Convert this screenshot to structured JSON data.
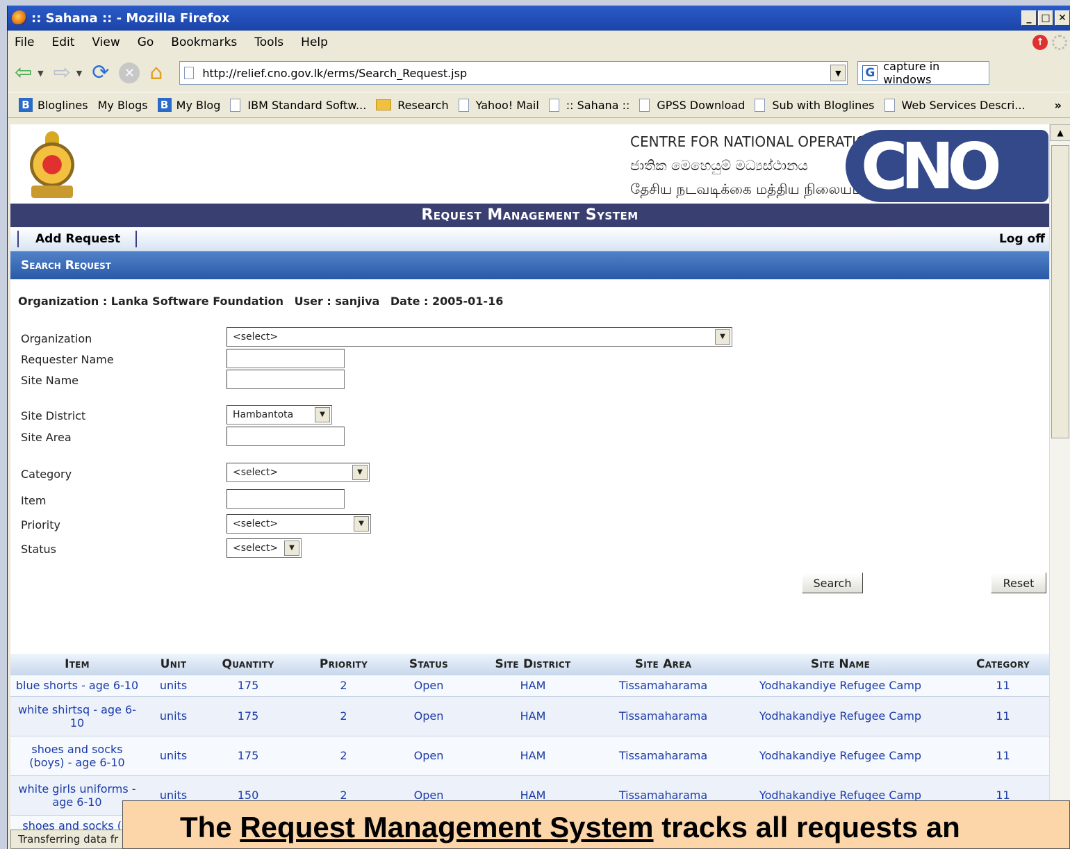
{
  "window": {
    "title": ":: Sahana :: - Mozilla Firefox"
  },
  "menu": [
    "File",
    "Edit",
    "View",
    "Go",
    "Bookmarks",
    "Tools",
    "Help"
  ],
  "address": {
    "url": "http://relief.cno.gov.lk/erms/Search_Request.jsp"
  },
  "search_engine": {
    "placeholder": "capture in windows"
  },
  "bookmarks": [
    {
      "label": "Bloglines",
      "icon": "b-icon"
    },
    {
      "label": "My Blogs",
      "icon": ""
    },
    {
      "label": "My Blog",
      "icon": "b-icon"
    },
    {
      "label": "IBM Standard Softw...",
      "icon": "page-icon"
    },
    {
      "label": "Research",
      "icon": "folder-icon"
    },
    {
      "label": "Yahoo! Mail",
      "icon": "page-icon"
    },
    {
      "label": ":: Sahana ::",
      "icon": "page-icon"
    },
    {
      "label": "GPSS Download",
      "icon": "page-icon"
    },
    {
      "label": "Sub with Bloglines",
      "icon": "page-icon"
    },
    {
      "label": "Web Services Descri...",
      "icon": "page-icon"
    }
  ],
  "header": {
    "line1": "CENTRE FOR NATIONAL OPERATIONS",
    "line2": "ජාතික මෙහෙයුම් මධ්‍යස්ථානය",
    "line3": "தேசிய நடவடிக்கை மத்திய நிலையம்",
    "logo": "CNO",
    "system_title": "Request Management System"
  },
  "actions": {
    "add_request": "Add Request",
    "log_off": "Log off"
  },
  "section_title": "Search Request",
  "info": {
    "organization": "Organization : Lanka Software Foundation",
    "user": "User : sanjiva",
    "date": "Date : 2005-01-16"
  },
  "form": {
    "organization_label": "Organization",
    "organization_value": "<select>",
    "requester_label": "Requester Name",
    "site_name_label": "Site Name",
    "site_district_label": "Site District",
    "site_district_value": "Hambantota",
    "site_area_label": "Site Area",
    "category_label": "Category",
    "category_value": "<select>",
    "item_label": "Item",
    "priority_label": "Priority",
    "priority_value": "<select>",
    "status_label": "Status",
    "status_value": "<select>",
    "search_button": "Search",
    "reset_button": "Reset"
  },
  "table": {
    "headers": [
      "Item",
      "Unit",
      "Quantity",
      "Priority",
      "Status",
      "Site District",
      "Site Area",
      "Site Name",
      "Category"
    ],
    "rows": [
      [
        "blue shorts - age 6-10",
        "units",
        "175",
        "2",
        "Open",
        "HAM",
        "Tissamaharama",
        "Yodhakandiye Refugee Camp",
        "11"
      ],
      [
        "white shirtsq - age 6-10",
        "units",
        "175",
        "2",
        "Open",
        "HAM",
        "Tissamaharama",
        "Yodhakandiye Refugee Camp",
        "11"
      ],
      [
        "shoes and socks (boys) - age 6-10",
        "units",
        "175",
        "2",
        "Open",
        "HAM",
        "Tissamaharama",
        "Yodhakandiye Refugee Camp",
        "11"
      ],
      [
        "white girls uniforms - age 6-10",
        "units",
        "150",
        "2",
        "Open",
        "HAM",
        "Tissamaharama",
        "Yodhakandiye Refugee Camp",
        "11"
      ],
      [
        "shoes and socks (gi",
        "",
        "",
        "",
        "",
        "",
        "",
        "",
        ""
      ]
    ]
  },
  "status_bar": "Transferring data fr",
  "caption": {
    "prefix": "The ",
    "link": "Request Management System",
    "suffix": " tracks all requests an"
  }
}
